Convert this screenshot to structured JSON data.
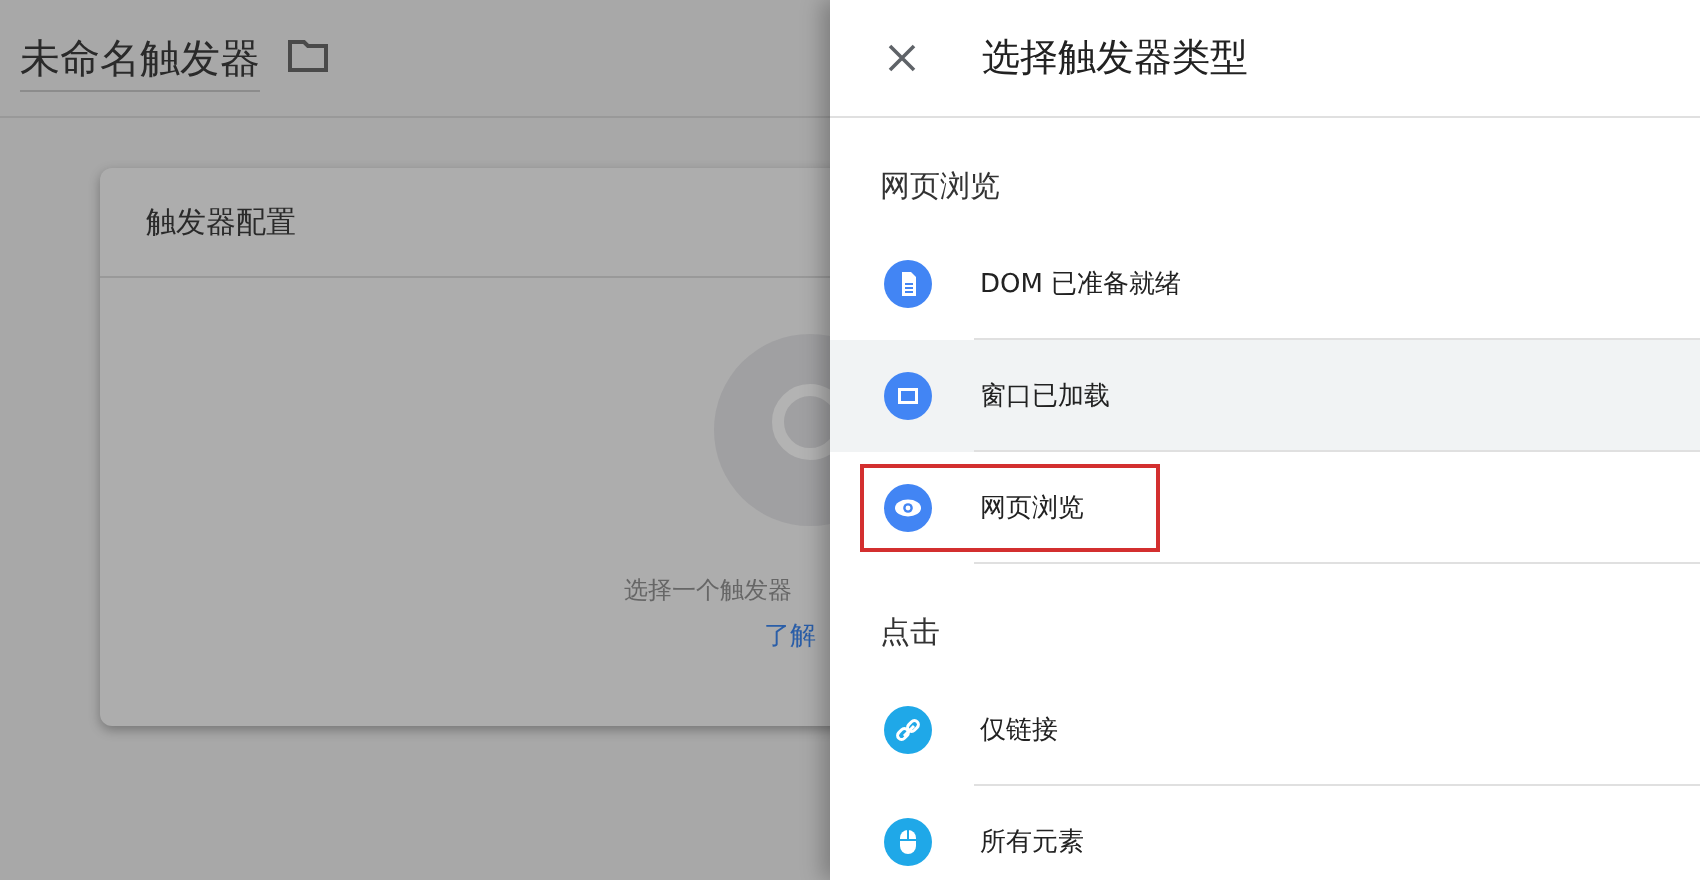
{
  "editor": {
    "title": "未命名触发器",
    "card": {
      "title": "触发器配置",
      "hint": "选择一个触发器",
      "link": "了解"
    }
  },
  "panel": {
    "title": "选择触发器类型",
    "sections": [
      {
        "label": "网页浏览",
        "items": [
          {
            "label": "DOM 已准备就绪",
            "kind": "document",
            "color": "#4285f4",
            "hovered": false,
            "highlighted": false
          },
          {
            "label": "窗口已加载",
            "kind": "window",
            "color": "#4285f4",
            "hovered": true,
            "highlighted": false
          },
          {
            "label": "网页浏览",
            "kind": "eye",
            "color": "#4285f4",
            "hovered": false,
            "highlighted": true
          }
        ]
      },
      {
        "label": "点击",
        "items": [
          {
            "label": "仅链接",
            "kind": "link",
            "color": "#1fa8e8",
            "hovered": false,
            "highlighted": false
          },
          {
            "label": "所有元素",
            "kind": "mouse",
            "color": "#1fa8e8",
            "hovered": false,
            "highlighted": false
          }
        ]
      }
    ]
  }
}
